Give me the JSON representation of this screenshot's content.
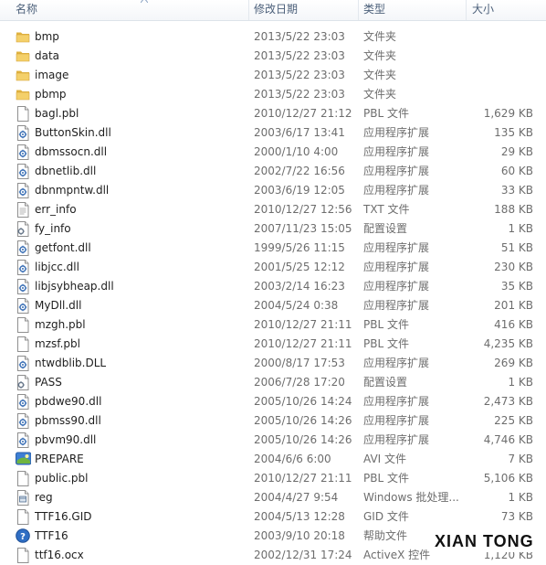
{
  "columns": {
    "name": "名称",
    "date": "修改日期",
    "type": "类型",
    "size": "大小"
  },
  "files": [
    {
      "icon": "folder-icon",
      "name": "bmp",
      "date": "2013/5/22 23:03",
      "type": "文件夹",
      "size": ""
    },
    {
      "icon": "folder-icon",
      "name": "data",
      "date": "2013/5/22 23:03",
      "type": "文件夹",
      "size": ""
    },
    {
      "icon": "folder-icon",
      "name": "image",
      "date": "2013/5/22 23:03",
      "type": "文件夹",
      "size": ""
    },
    {
      "icon": "folder-icon",
      "name": "pbmp",
      "date": "2013/5/22 23:03",
      "type": "文件夹",
      "size": ""
    },
    {
      "icon": "file-icon",
      "name": "bagl.pbl",
      "date": "2010/12/27 21:12",
      "type": "PBL 文件",
      "size": "1,629 KB"
    },
    {
      "icon": "dll-icon",
      "name": "ButtonSkin.dll",
      "date": "2003/6/17 13:41",
      "type": "应用程序扩展",
      "size": "135 KB"
    },
    {
      "icon": "dll-icon",
      "name": "dbmssocn.dll",
      "date": "2000/1/10 4:00",
      "type": "应用程序扩展",
      "size": "29 KB"
    },
    {
      "icon": "dll-icon",
      "name": "dbnetlib.dll",
      "date": "2002/7/22 16:56",
      "type": "应用程序扩展",
      "size": "60 KB"
    },
    {
      "icon": "dll-icon",
      "name": "dbnmpntw.dll",
      "date": "2003/6/19 12:05",
      "type": "应用程序扩展",
      "size": "33 KB"
    },
    {
      "icon": "text-file-icon",
      "name": "err_info",
      "date": "2010/12/27 12:56",
      "type": "TXT 文件",
      "size": "188 KB"
    },
    {
      "icon": "config-file-icon",
      "name": "fy_info",
      "date": "2007/11/23 15:05",
      "type": "配置设置",
      "size": "1 KB"
    },
    {
      "icon": "dll-icon",
      "name": "getfont.dll",
      "date": "1999/5/26 11:15",
      "type": "应用程序扩展",
      "size": "51 KB"
    },
    {
      "icon": "dll-icon",
      "name": "libjcc.dll",
      "date": "2001/5/25 12:12",
      "type": "应用程序扩展",
      "size": "230 KB"
    },
    {
      "icon": "dll-icon",
      "name": "libjsybheap.dll",
      "date": "2003/2/14 16:23",
      "type": "应用程序扩展",
      "size": "35 KB"
    },
    {
      "icon": "dll-icon",
      "name": "MyDll.dll",
      "date": "2004/5/24 0:38",
      "type": "应用程序扩展",
      "size": "201 KB"
    },
    {
      "icon": "file-icon",
      "name": "mzgh.pbl",
      "date": "2010/12/27 21:11",
      "type": "PBL 文件",
      "size": "416 KB"
    },
    {
      "icon": "file-icon",
      "name": "mzsf.pbl",
      "date": "2010/12/27 21:11",
      "type": "PBL 文件",
      "size": "4,235 KB"
    },
    {
      "icon": "dll-icon",
      "name": "ntwdblib.DLL",
      "date": "2000/8/17 17:53",
      "type": "应用程序扩展",
      "size": "269 KB"
    },
    {
      "icon": "config-file-icon",
      "name": "PASS",
      "date": "2006/7/28 17:20",
      "type": "配置设置",
      "size": "1 KB"
    },
    {
      "icon": "dll-icon",
      "name": "pbdwe90.dll",
      "date": "2005/10/26 14:24",
      "type": "应用程序扩展",
      "size": "2,473 KB"
    },
    {
      "icon": "dll-icon",
      "name": "pbmss90.dll",
      "date": "2005/10/26 14:26",
      "type": "应用程序扩展",
      "size": "225 KB"
    },
    {
      "icon": "dll-icon",
      "name": "pbvm90.dll",
      "date": "2005/10/26 14:26",
      "type": "应用程序扩展",
      "size": "4,746 KB"
    },
    {
      "icon": "video-file-icon",
      "name": "PREPARE",
      "date": "2004/6/6 6:00",
      "type": "AVI 文件",
      "size": "7 KB"
    },
    {
      "icon": "file-icon",
      "name": "public.pbl",
      "date": "2010/12/27 21:11",
      "type": "PBL 文件",
      "size": "5,106 KB"
    },
    {
      "icon": "registry-file-icon",
      "name": "reg",
      "date": "2004/4/27 9:54",
      "type": "Windows 批处理...",
      "size": "1 KB"
    },
    {
      "icon": "file-icon",
      "name": "TTF16.GID",
      "date": "2004/5/13 12:28",
      "type": "GID 文件",
      "size": "73 KB"
    },
    {
      "icon": "help-file-icon",
      "name": "TTF16",
      "date": "2003/9/10 20:18",
      "type": "帮助文件",
      "size": "1,848 KB"
    },
    {
      "icon": "file-icon",
      "name": "ttf16.ocx",
      "date": "2002/12/31 17:24",
      "type": "ActiveX 控件",
      "size": "1,120 KB"
    }
  ],
  "watermark": "XIAN TONG"
}
